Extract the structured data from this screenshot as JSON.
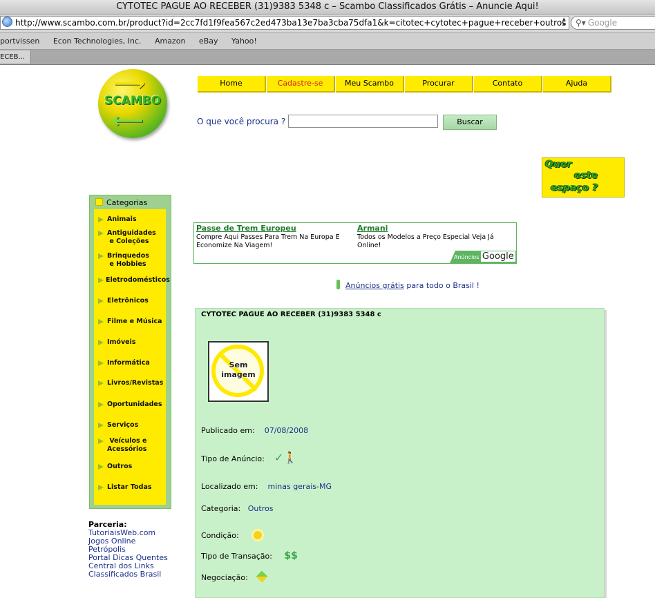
{
  "browser": {
    "window_title": "CYTOTEC PAGUE AO RECEBER (31)9383 5348 c – Scambo Classificados Grátis – Anuncie Aqui!",
    "url": "http://www.scambo.com.br/product?id=2cc7fd1f9fea567c2ed473ba13e7ba3cba75dfa1&k=citotec+cytotec+pague+receber+outros",
    "search_placeholder": "Google",
    "bookmarks": [
      "portvissen",
      "Econ Technologies, Inc.",
      "Amazon",
      "eBay",
      "Yahoo!"
    ],
    "tab_label": "ECEB..."
  },
  "logo": {
    "text": "SCAMBO"
  },
  "nav": {
    "items": [
      {
        "label": "Home"
      },
      {
        "label": "Cadastre-se"
      },
      {
        "label": "Meu Scambo"
      },
      {
        "label": "Procurar"
      },
      {
        "label": "Contato"
      },
      {
        "label": "Ajuda"
      }
    ]
  },
  "search": {
    "label": "O que você procura ?",
    "value": "",
    "button": "Buscar"
  },
  "adspace": {
    "line1": "Quer",
    "line2": "este",
    "line3": "espaço ?"
  },
  "categories": {
    "title": "Categorias",
    "items": [
      {
        "label": "Animais"
      },
      {
        "label": "Antiguidades",
        "label2": "e Coleções"
      },
      {
        "label": "Brinquedos",
        "label2": "e Hobbies"
      },
      {
        "label": "Eletrodomésticos"
      },
      {
        "label": "Eletrônicos"
      },
      {
        "label": "Filme e Música"
      },
      {
        "label": "Imóveis"
      },
      {
        "label": "Informática"
      },
      {
        "label": "Livros/Revistas"
      },
      {
        "label": "Oportunidades"
      },
      {
        "label": "Serviços"
      },
      {
        "label": "Veículos e",
        "label2": "Acessórios"
      },
      {
        "label": "Outros"
      },
      {
        "label": "Listar Todas"
      }
    ]
  },
  "partners": {
    "title": "Parceria:",
    "links": [
      "TutoriaisWeb.com",
      "Jogos Online",
      "Petrópolis",
      "Portal Dicas Quentes",
      "Central dos Links",
      "Classificados Brasil"
    ]
  },
  "google_ads": {
    "ad1_title": "Passe de Trem Europeu",
    "ad1_text": "Compre Aqui Passes Para Trem Na Europa E Economize Na Viagem!",
    "ad2_title": "Armani",
    "ad2_text": "Todos os Modelos a Preço Especial Veja Já Online!",
    "badge_small": "Anúncios",
    "badge_brand": "Google"
  },
  "free_ads": {
    "link": "Anúncios grátis",
    "rest": " para todo o Brasil !"
  },
  "product": {
    "title": "CYTOTEC PAGUE AO RECEBER (31)9383 5348 c",
    "no_image_line1": "Sem",
    "no_image_line2": "imagem",
    "published_label": "Publicado em:",
    "published_value": "07/08/2008",
    "type_label": "Tipo de Anúncio:",
    "location_label": "Localizado em:",
    "location_value": "minas gerais-MG",
    "category_label": "Categoria:",
    "category_value": "Outros",
    "condition_label": "Condição:",
    "transaction_label": "Tipo de Transação:",
    "transaction_value": "$$",
    "negotiation_label": "Negociação:"
  }
}
